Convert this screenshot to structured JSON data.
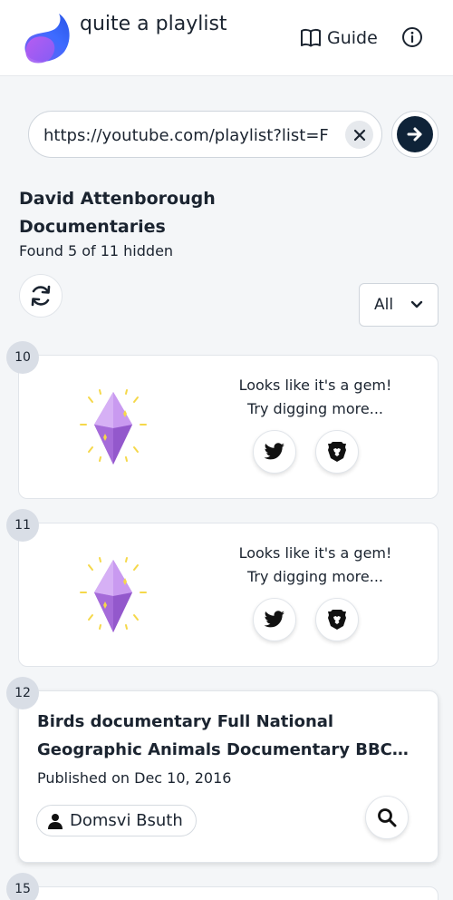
{
  "app": {
    "name": "quite a playlist",
    "guide_label": "Guide"
  },
  "search": {
    "url_value": "https://youtube.com/playlist?list=F"
  },
  "playlist": {
    "title": "David Attenborough Documentaries",
    "found_text": "Found 5 of 11 hidden",
    "filter_value": "All"
  },
  "cards": [
    {
      "index": "10",
      "type": "gem",
      "message_line1": "Looks like it's a gem!",
      "message_line2": "Try digging more..."
    },
    {
      "index": "11",
      "type": "gem",
      "message_line1": "Looks like it's a gem!",
      "message_line2": "Try digging more..."
    },
    {
      "index": "12",
      "type": "video",
      "title": "Birds documentary Full National Geographic Animals Documentary BBC Documentary...",
      "published": "Published on Dec 10, 2016",
      "channel": "Domsvi Bsuth"
    },
    {
      "index": "15",
      "type": "partial"
    }
  ],
  "colors": {
    "brand_gradient_start": "#3d6bff",
    "brand_gradient_end": "#b05cf0",
    "dark_navy": "#0f2338",
    "gem_purple": "#b57be6",
    "badge_bg": "#d9dee6"
  },
  "icons": [
    "app-logo",
    "book-icon",
    "info-icon",
    "clear-icon",
    "arrow-right-icon",
    "refresh-icon",
    "chevron-down-icon",
    "gem-icon",
    "twitter-icon",
    "brave-icon",
    "person-icon",
    "search-icon"
  ]
}
